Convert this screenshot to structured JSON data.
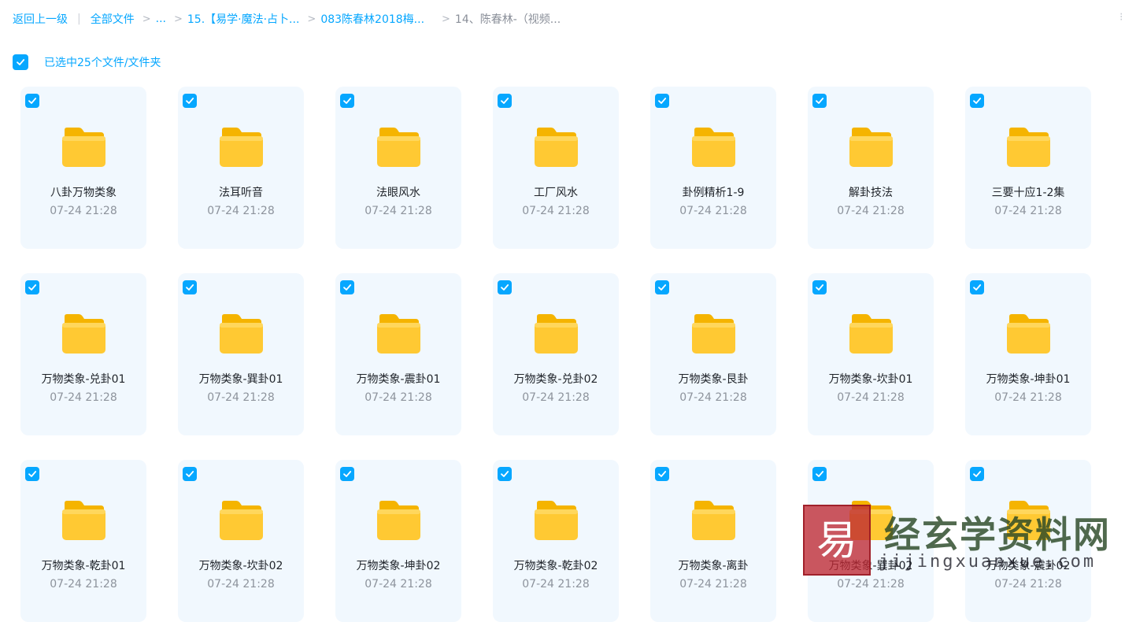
{
  "breadcrumb": {
    "back": "返回上一级",
    "all_files": "全部文件",
    "ellipsis": "...",
    "level1": "15.【易学·魔法·占卜...",
    "level2": "083陈春林2018梅...",
    "current": "14、陈春林-（视频..."
  },
  "selection": {
    "text": "已选中25个文件/文件夹"
  },
  "folders": [
    {
      "name": "八卦万物类象",
      "date": "07-24 21:28"
    },
    {
      "name": "法耳听音",
      "date": "07-24 21:28"
    },
    {
      "name": "法眼风水",
      "date": "07-24 21:28"
    },
    {
      "name": "工厂风水",
      "date": "07-24 21:28"
    },
    {
      "name": "卦例精析1-9",
      "date": "07-24 21:28"
    },
    {
      "name": "解卦技法",
      "date": "07-24 21:28"
    },
    {
      "name": "三要十应1-2集",
      "date": "07-24 21:28"
    },
    {
      "name": "万物类象-兑卦01",
      "date": "07-24 21:28"
    },
    {
      "name": "万物类象-巽卦01",
      "date": "07-24 21:28"
    },
    {
      "name": "万物类象-震卦01",
      "date": "07-24 21:28"
    },
    {
      "name": "万物类象-兑卦02",
      "date": "07-24 21:28"
    },
    {
      "name": "万物类象-艮卦",
      "date": "07-24 21:28"
    },
    {
      "name": "万物类象-坎卦01",
      "date": "07-24 21:28"
    },
    {
      "name": "万物类象-坤卦01",
      "date": "07-24 21:28"
    },
    {
      "name": "万物类象-乾卦01",
      "date": "07-24 21:28"
    },
    {
      "name": "万物类象-坎卦02",
      "date": "07-24 21:28"
    },
    {
      "name": "万物类象-坤卦02",
      "date": "07-24 21:28"
    },
    {
      "name": "万物类象-乾卦02",
      "date": "07-24 21:28"
    },
    {
      "name": "万物类象-离卦",
      "date": "07-24 21:28"
    },
    {
      "name": "万物类象-巽卦02",
      "date": "07-24 21:28"
    },
    {
      "name": "万物类象-震卦02",
      "date": "07-24 21:28"
    }
  ],
  "watermark": {
    "title": "经玄学资料网",
    "url": "jijingxuanxue.com",
    "logo_char": "易"
  },
  "colors": {
    "accent": "#06a7ff",
    "card_bg": "#f1f8fe",
    "folder": "#ffc933"
  },
  "icons": {
    "checkbox": "checkbox-checked-icon",
    "folder": "folder-icon"
  }
}
